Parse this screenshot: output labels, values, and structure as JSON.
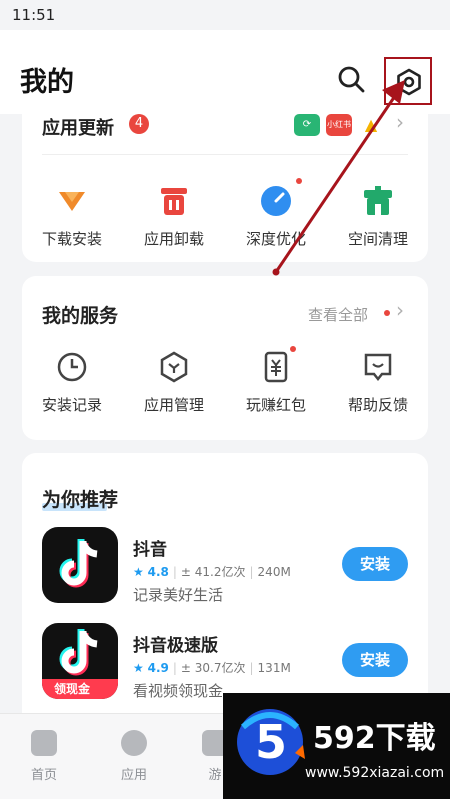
{
  "status_bar": {
    "time": "11:51"
  },
  "header": {
    "title": "我的",
    "search_icon": "search-icon",
    "settings_icon": "settings-icon"
  },
  "updates": {
    "title": "应用更新",
    "badge": "4",
    "mini_apps": [
      {
        "label": "⟳",
        "color": "#29b574"
      },
      {
        "label": "小红书",
        "color": "#e9463e"
      },
      {
        "label": "▲",
        "color": "#f5b301"
      }
    ],
    "tools": [
      {
        "label": "下载安装",
        "icon": "download-icon",
        "color": "#f08a2a"
      },
      {
        "label": "应用卸载",
        "icon": "trash-icon",
        "color": "#e9463e"
      },
      {
        "label": "深度优化",
        "icon": "optimize-icon",
        "color": "#2f8ef0"
      },
      {
        "label": "空间清理",
        "icon": "broom-icon",
        "color": "#22a96b"
      }
    ]
  },
  "services": {
    "title": "我的服务",
    "see_all": "查看全部",
    "items": [
      {
        "label": "安装记录",
        "icon": "history-icon"
      },
      {
        "label": "应用管理",
        "icon": "app-manage-icon"
      },
      {
        "label": "玩赚红包",
        "icon": "red-packet-icon"
      },
      {
        "label": "帮助反馈",
        "icon": "feedback-icon"
      }
    ]
  },
  "recommend": {
    "title": "为你推荐",
    "apps": [
      {
        "name": "抖音",
        "star": "★",
        "rating": "4.8",
        "downloads": "± 41.2亿次",
        "size": "240M",
        "desc": "记录美好生活",
        "install": "安装",
        "icon": "douyin-icon"
      },
      {
        "name": "抖音极速版",
        "star": "★",
        "rating": "4.9",
        "downloads": "± 30.7亿次",
        "size": "131M",
        "desc": "看视频领现金",
        "install": "安装",
        "icon": "douyin-lite-icon",
        "ribbon": "领现金"
      }
    ]
  },
  "bottom_nav": [
    {
      "label": "首页",
      "icon": "home-icon"
    },
    {
      "label": "应用",
      "icon": "apps-icon"
    },
    {
      "label": "游",
      "icon": "games-icon"
    }
  ],
  "watermark": {
    "title": "592下载",
    "url": "www.592xiazai.com",
    "logo": "5"
  },
  "colors": {
    "accent": "#2f9cf2",
    "annotation": "#a7141c",
    "badge": "#e9463e"
  }
}
